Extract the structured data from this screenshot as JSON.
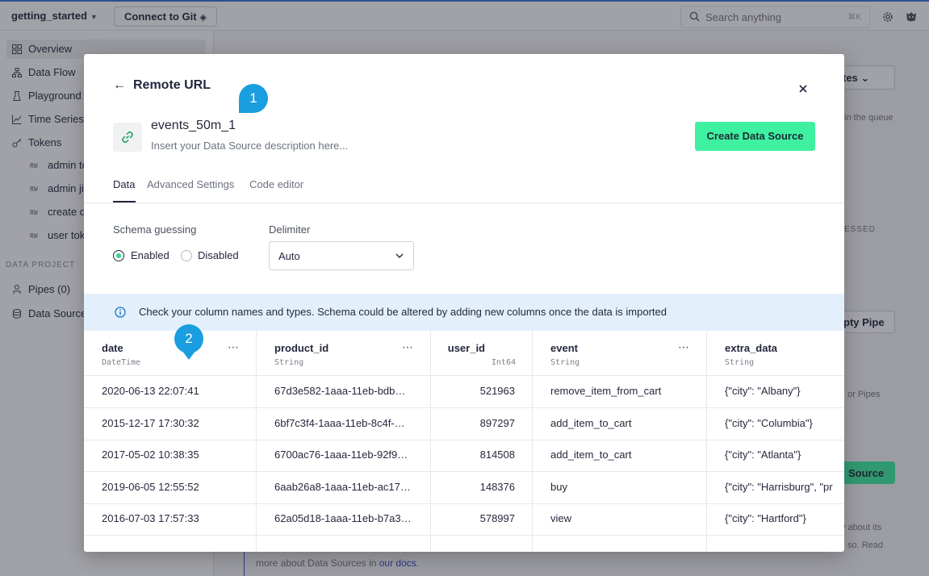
{
  "topbar": {
    "workspace": "getting_started",
    "git_button": "Connect to Git",
    "search_placeholder": "Search anything",
    "search_shortcut": "⌘K"
  },
  "sidebar": {
    "items": [
      {
        "label": "Overview"
      },
      {
        "label": "Data Flow"
      },
      {
        "label": "Playground"
      },
      {
        "label": "Time Series"
      },
      {
        "label": "Tokens"
      }
    ],
    "tokens": [
      {
        "badge": "RW",
        "label": "admin to"
      },
      {
        "badge": "RW",
        "label": "admin ji"
      },
      {
        "badge": "RW",
        "label": "create d"
      },
      {
        "badge": "RW",
        "label": "user tok"
      }
    ],
    "section_label": "DATA PROJECT",
    "pipes_label": "Pipes (0)",
    "datasources_label": "Data Source"
  },
  "background": {
    "btn_tes": "tes",
    "queue_text": "in the queue",
    "essed_text": "ESSED",
    "empty_pipe": "pty Pipe",
    "or_pipes": "or Pipes",
    "source_btn": "Source",
    "about_its": "y about its",
    "so_read": "so. Read",
    "docs_prefix": "more about Data Sources in ",
    "docs_link": "our docs",
    "docs_suffix": "."
  },
  "modal": {
    "back_arrow": "←",
    "title": "Remote URL",
    "datasource_name": "events_50m_1",
    "description_placeholder": "Insert your Data Source description here...",
    "create_button": "Create Data Source",
    "tabs": [
      "Data",
      "Advanced Settings",
      "Code editor"
    ],
    "schema_label": "Schema guessing",
    "schema_options": [
      "Enabled",
      "Disabled"
    ],
    "schema_selected": "Enabled",
    "delimiter_label": "Delimiter",
    "delimiter_value": "Auto",
    "info_text": "Check your column names and types. Schema could be altered by adding new columns once the data is imported",
    "badges": [
      "1",
      "2"
    ]
  },
  "table": {
    "columns": [
      {
        "name": "date",
        "type": "DateTime"
      },
      {
        "name": "product_id",
        "type": "String"
      },
      {
        "name": "user_id",
        "type": "Int64"
      },
      {
        "name": "event",
        "type": "String"
      },
      {
        "name": "extra_data",
        "type": "String"
      }
    ],
    "rows": [
      [
        "2020-06-13 22:07:41",
        "67d3e582-1aaa-11eb-bdb…",
        "521963",
        "remove_item_from_cart",
        "{\"city\": \"Albany\"}"
      ],
      [
        "2015-12-17 17:30:32",
        "6bf7c3f4-1aaa-11eb-8c4f-…",
        "897297",
        "add_item_to_cart",
        "{\"city\": \"Columbia\"}"
      ],
      [
        "2017-05-02 10:38:35",
        "6700ac76-1aaa-11eb-92f9…",
        "814508",
        "add_item_to_cart",
        "{\"city\": \"Atlanta\"}"
      ],
      [
        "2019-06-05 12:55:52",
        "6aab26a8-1aaa-11eb-ac17…",
        "148376",
        "buy",
        "{\"city\": \"Harrisburg\", \"pr"
      ],
      [
        "2016-07-03 17:57:33",
        "62a05d18-1aaa-11eb-b7a3…",
        "578997",
        "view",
        "{\"city\": \"Hartford\"}"
      ],
      [
        "",
        "",
        "",
        "",
        ""
      ]
    ]
  }
}
